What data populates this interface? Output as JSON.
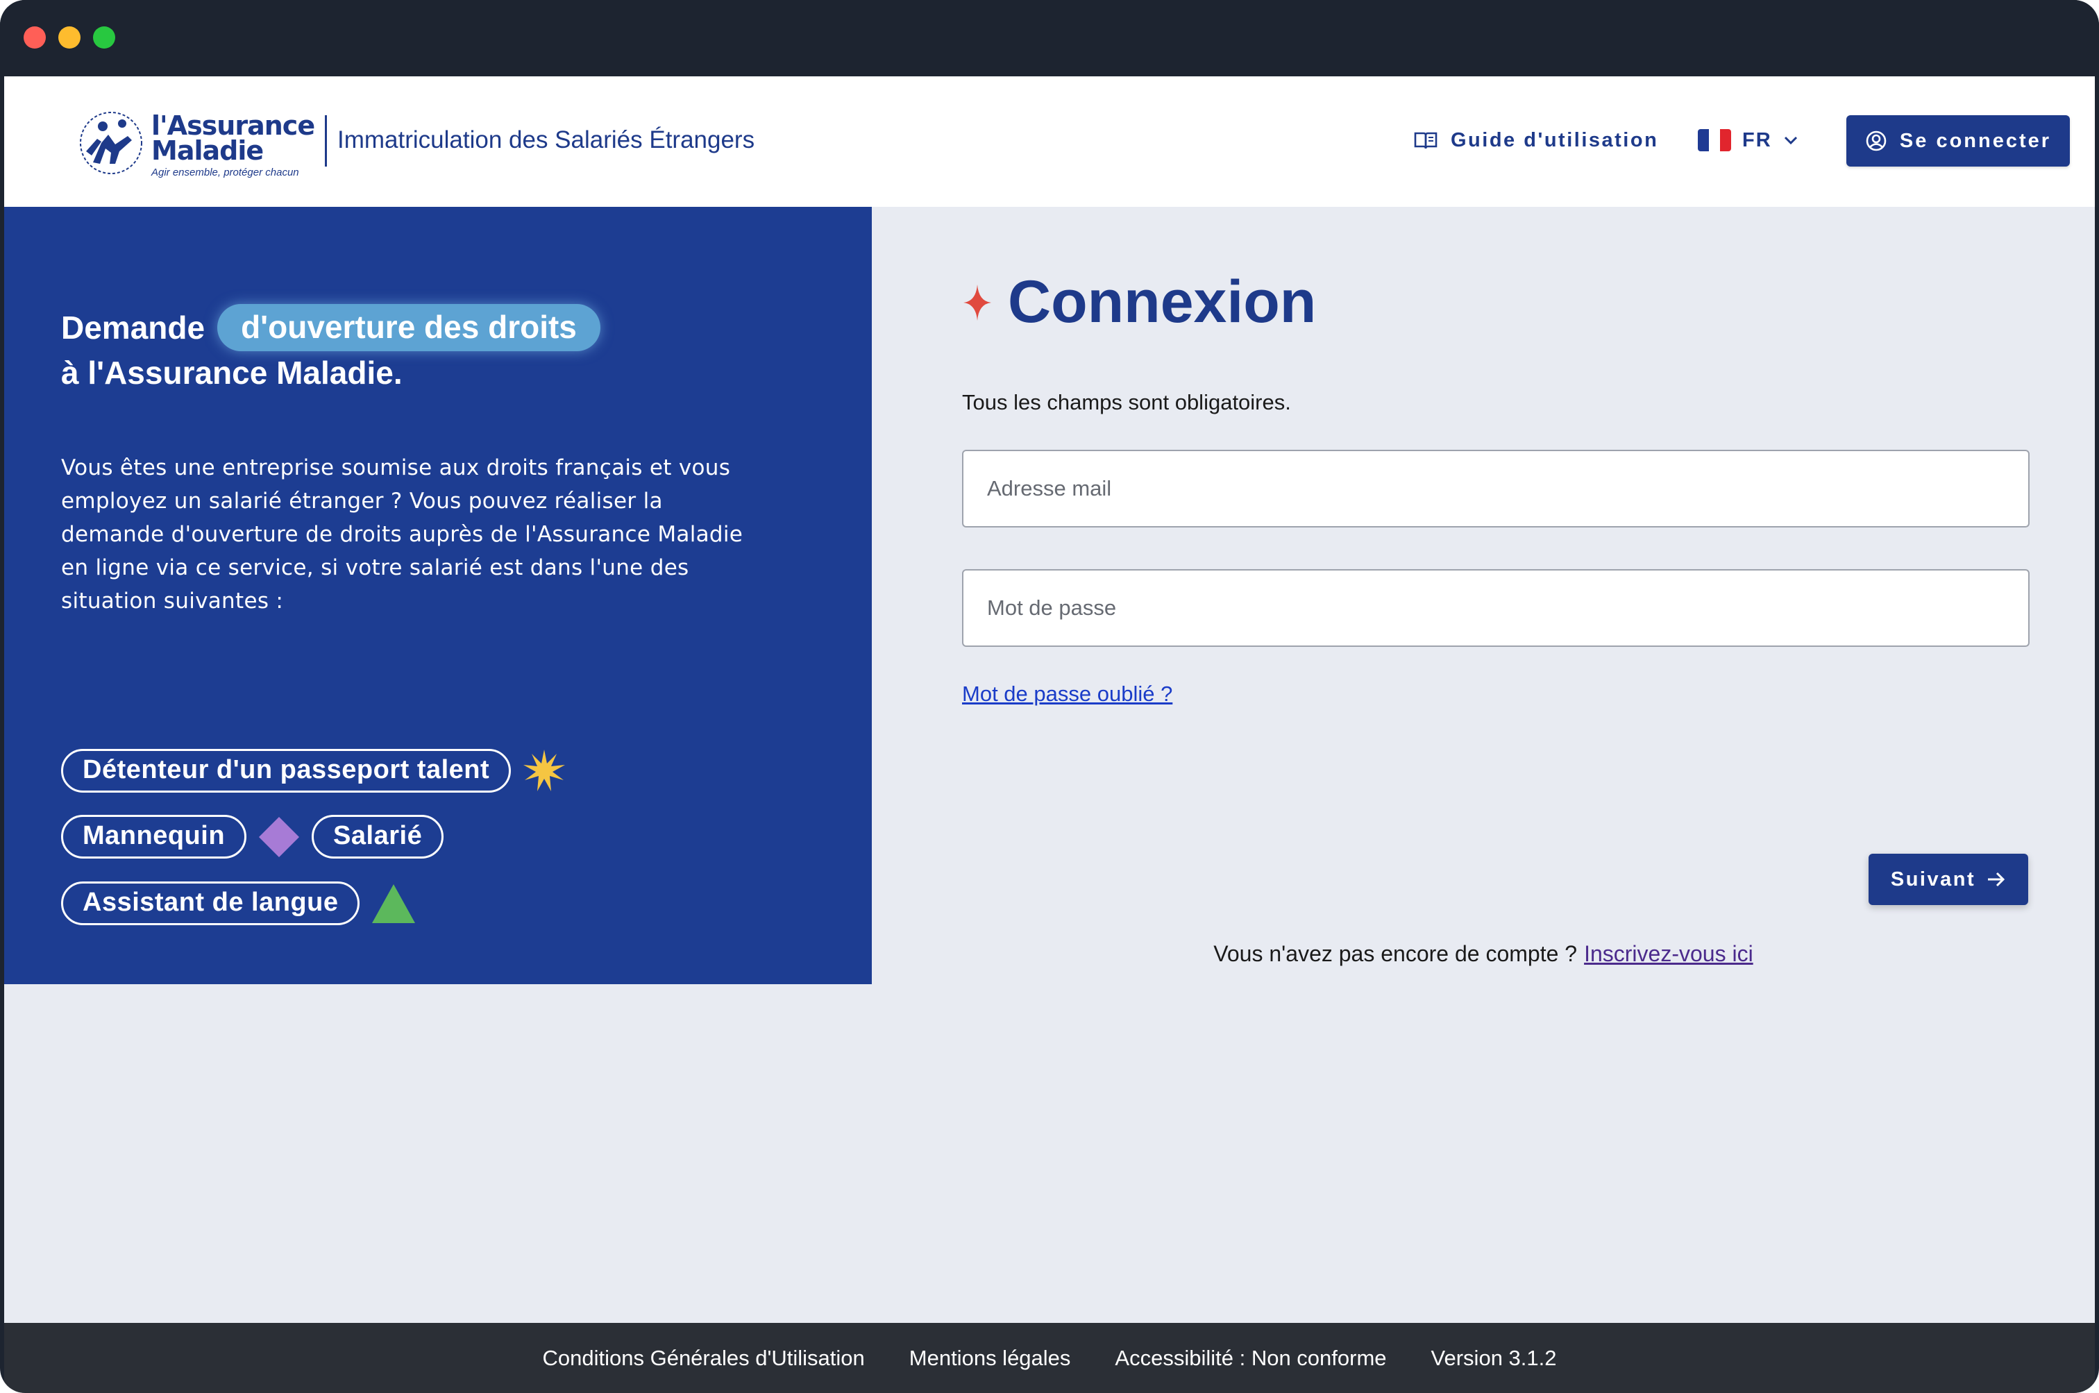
{
  "header": {
    "logo_line1": "l'Assurance",
    "logo_line2": "Maladie",
    "logo_tagline": "Agir ensemble, protéger chacun",
    "app_title": "Immatriculation des Salariés Étrangers",
    "guide_label": "Guide d'utilisation",
    "language": "FR",
    "connect_label": "Se connecter"
  },
  "hero": {
    "title_prefix": "Demande",
    "title_highlight": "d'ouverture des droits",
    "title_line2": "à l'Assurance Maladie.",
    "description": "Vous êtes une entreprise soumise aux droits français et vous employez un salarié étranger ? Vous pouvez réaliser la demande d'ouverture de droits auprès de l'Assurance Maladie en ligne via ce service, si votre salarié est dans l'une des situation suivantes :",
    "tags": [
      "Détenteur d'un passeport talent",
      "Mannequin",
      "Salarié",
      "Assistant de langue"
    ]
  },
  "login": {
    "title": "Connexion",
    "required_note": "Tous les champs sont obligatoires.",
    "email_placeholder": "Adresse mail",
    "email_value": "",
    "password_placeholder": "Mot de passe",
    "password_value": "",
    "forgot_password": "Mot de passe oublié ?",
    "next_label": "Suivant",
    "signup_prompt": "Vous n'avez pas encore de compte ?",
    "signup_link": "Inscrivez-vous ici"
  },
  "footer": {
    "links": [
      "Conditions Générales d'Utilisation",
      "Mentions légales",
      "Accessibilité : Non conforme",
      "Version 3.1.2"
    ]
  },
  "colors": {
    "brand_blue": "#1e3a8a",
    "panel_blue": "#1d3d92",
    "highlight_blue": "#5da3d3",
    "star_yellow": "#f5c542",
    "diamond_purple": "#a77bd6",
    "triangle_green": "#5cb85c",
    "accent_red": "#e04a3f"
  }
}
